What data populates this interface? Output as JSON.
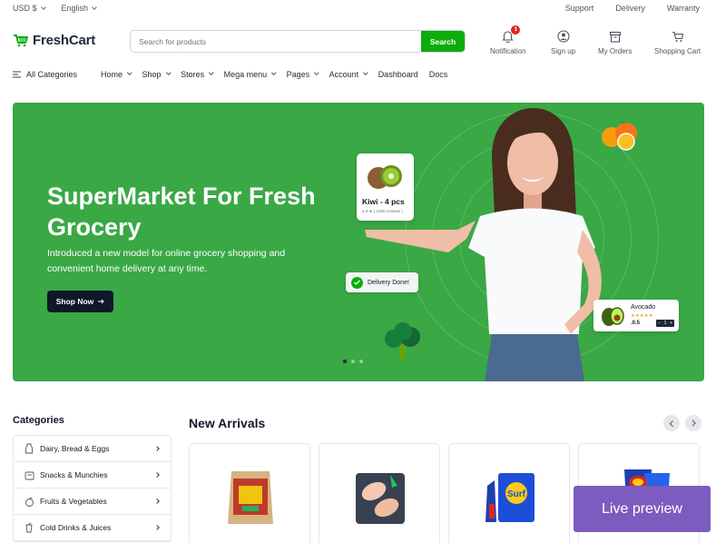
{
  "topbar": {
    "currency": "USD $",
    "language": "English",
    "links": [
      "Support",
      "Delivery",
      "Warranty"
    ]
  },
  "brand": {
    "name": "FreshCart",
    "color": "#0aad0a"
  },
  "search": {
    "placeholder": "Search for products",
    "button": "Search"
  },
  "header_icons": {
    "notification": {
      "label": "Notification",
      "count": "1",
      "icon": "bell-icon"
    },
    "signup": {
      "label": "Sign up",
      "icon": "user-icon"
    },
    "orders": {
      "label": "My Orders",
      "icon": "box-icon"
    },
    "cart": {
      "label": "Shopping Cart",
      "icon": "cart-icon"
    }
  },
  "nav": {
    "all_categories": "All Categories",
    "items": [
      "Home",
      "Shop",
      "Stores",
      "Mega menu",
      "Pages",
      "Account",
      "Dashboard",
      "Docs"
    ]
  },
  "hero": {
    "title": "SuperMarket For Fresh Grocery",
    "subtitle": "Introduced a new model for online grocery shopping and convenient home delivery at any time.",
    "cta": "Shop Now",
    "background": "#3aa845",
    "kiwi_card": {
      "title": "Kiwi - 4 pcs",
      "rating": "4.9 ★ ( 2450 reviews )"
    },
    "delivery_pill": "Delivery Done!",
    "avocado_card": {
      "name": "Avocado",
      "stars": "★★★★★",
      "price": ".0.5",
      "qty": "1"
    },
    "slides": 3,
    "active_slide": 1
  },
  "categories": {
    "title": "Categories",
    "items": [
      {
        "label": "Dairy, Bread & Eggs",
        "icon": "milk-icon"
      },
      {
        "label": "Snacks & Munchies",
        "icon": "snack-icon"
      },
      {
        "label": "Fruits & Vegetables",
        "icon": "fruit-icon"
      },
      {
        "label": "Cold Drinks & Juices",
        "icon": "drink-icon"
      }
    ]
  },
  "new_arrivals": {
    "title": "New Arrivals"
  },
  "live_preview": {
    "label": "Live preview",
    "color": "#7c5cbf"
  }
}
